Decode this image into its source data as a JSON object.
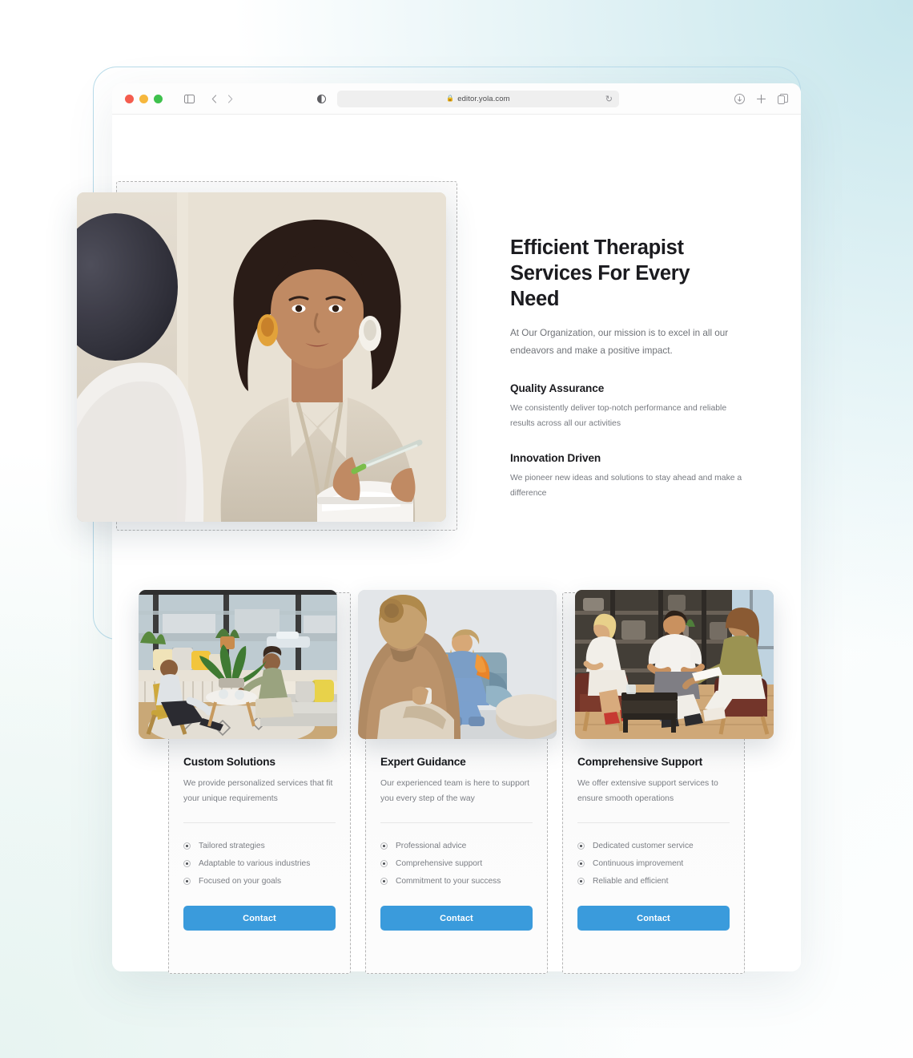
{
  "browser": {
    "traffic_lights": [
      "close",
      "minimize",
      "zoom"
    ],
    "sidebar_toggle_label": "Show Sidebar",
    "back_label": "Back",
    "forward_label": "Forward",
    "reader_label": "Reader View",
    "url": "editor.yola.com",
    "lock": "secure",
    "reload_label": "Reload",
    "download_label": "Downloads",
    "new_tab_label": "New Tab",
    "tab_overview_label": "Tab Overview"
  },
  "hero": {
    "title_line1": "Efficient Therapist",
    "title_line2": "Services For Every Need",
    "subtitle": "At Our Organization, our mission is to excel in all our endeavors and make a positive impact.",
    "image_alt": "Therapist in session taking notes",
    "features": [
      {
        "title": "Quality Assurance",
        "text": "We consistently deliver top-notch performance and reliable results across all our activities"
      },
      {
        "title": "Innovation Driven",
        "text": "We pioneer new ideas and solutions to stay ahead and make a difference"
      }
    ]
  },
  "cards": [
    {
      "title": "Custom Solutions",
      "description": "We provide personalized services that fit your unique requirements",
      "image_alt": "Two people talking in a sunlit living room",
      "items": [
        "Tailored strategies",
        "Adaptable to various industries",
        "Focused on your goals"
      ],
      "button_label": "Contact"
    },
    {
      "title": "Expert Guidance",
      "description": "Our experienced team is here to support you every step of the way",
      "image_alt": "Counselling session with two women",
      "items": [
        "Professional advice",
        "Comprehensive support",
        "Commitment to your success"
      ],
      "button_label": "Contact"
    },
    {
      "title": "Comprehensive Support",
      "description": "We offer extensive support services to ensure smooth operations",
      "image_alt": "Group therapy session with three people",
      "items": [
        "Dedicated customer service",
        "Continuous improvement",
        "Reliable and efficient"
      ],
      "button_label": "Contact"
    }
  ],
  "colors": {
    "accent_blue": "#3a9bdc",
    "frame_border": "#b9dcea",
    "heading": "#1b1b1f",
    "body_text": "#7b7e84",
    "dashed_outline": "#b5b5b5"
  }
}
